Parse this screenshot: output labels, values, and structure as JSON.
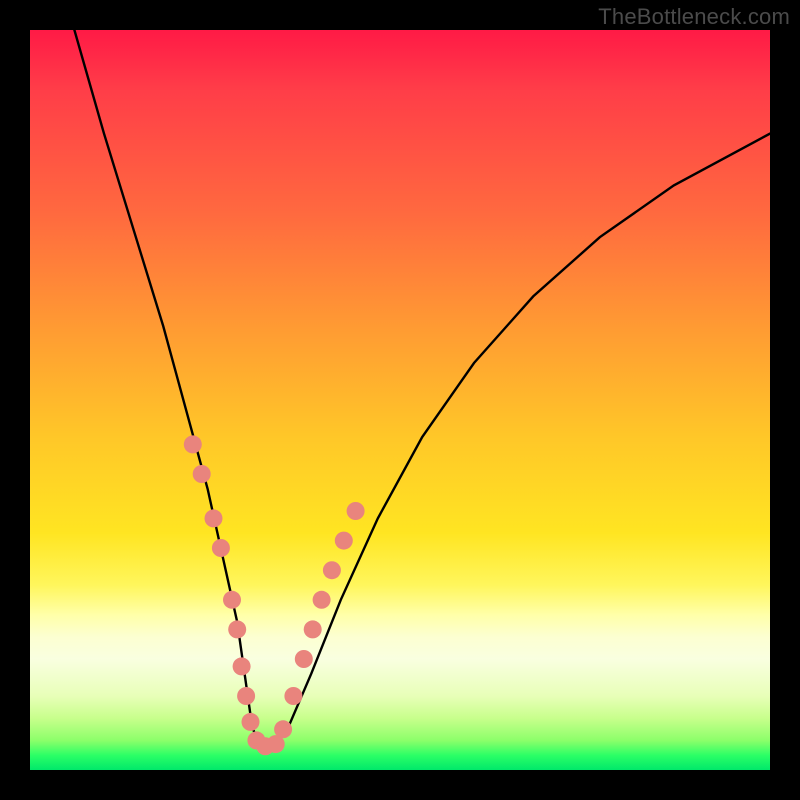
{
  "watermark": "TheBottleneck.com",
  "chart_data": {
    "type": "line",
    "title": "",
    "xlabel": "",
    "ylabel": "",
    "xlim": [
      0,
      100
    ],
    "ylim": [
      0,
      100
    ],
    "series": [
      {
        "name": "curve",
        "x": [
          6,
          10,
          14,
          18,
          21,
          24,
          26,
          28,
          29,
          30,
          31,
          33,
          35,
          38,
          42,
          47,
          53,
          60,
          68,
          77,
          87,
          100
        ],
        "values": [
          100,
          86,
          73,
          60,
          49,
          38,
          29,
          20,
          13,
          6,
          3,
          3,
          6,
          13,
          23,
          34,
          45,
          55,
          64,
          72,
          79,
          86
        ]
      }
    ],
    "markers": {
      "name": "beads",
      "color": "#e9847d",
      "radius": 9,
      "points": [
        {
          "x": 22.0,
          "y": 44
        },
        {
          "x": 23.2,
          "y": 40
        },
        {
          "x": 24.8,
          "y": 34
        },
        {
          "x": 25.8,
          "y": 30
        },
        {
          "x": 27.3,
          "y": 23
        },
        {
          "x": 28.0,
          "y": 19
        },
        {
          "x": 28.6,
          "y": 14
        },
        {
          "x": 29.2,
          "y": 10
        },
        {
          "x": 29.8,
          "y": 6.5
        },
        {
          "x": 30.6,
          "y": 4.0
        },
        {
          "x": 31.8,
          "y": 3.2
        },
        {
          "x": 33.2,
          "y": 3.5
        },
        {
          "x": 34.2,
          "y": 5.5
        },
        {
          "x": 35.6,
          "y": 10
        },
        {
          "x": 37.0,
          "y": 15
        },
        {
          "x": 38.2,
          "y": 19
        },
        {
          "x": 39.4,
          "y": 23
        },
        {
          "x": 40.8,
          "y": 27
        },
        {
          "x": 42.4,
          "y": 31
        },
        {
          "x": 44.0,
          "y": 35
        }
      ]
    }
  }
}
